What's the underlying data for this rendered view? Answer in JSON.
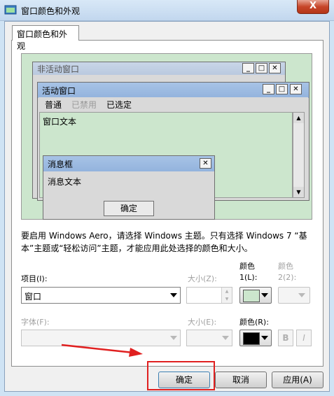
{
  "window": {
    "title": "窗口颜色和外观",
    "close_glyph": "X"
  },
  "tab": {
    "label": "窗口颜色和外观"
  },
  "preview": {
    "inactive_title": "非活动窗口",
    "active_title": "活动窗口",
    "menu": [
      "普通",
      "已禁用",
      "已选定"
    ],
    "window_text": "窗口文本",
    "msgbox_title": "消息框",
    "msgbox_text": "消息文本",
    "msgbox_ok": "确定"
  },
  "notice": "要启用 Windows Aero，请选择 Windows 主题。只有选择 Windows 7 “基本”主题或“轻松访问”主题，才能应用此处选择的颜色和大小。",
  "form": {
    "item_label": "项目(I):",
    "item_value": "窗口",
    "size1_label": "大小(Z):",
    "color1_label_a": "颜色",
    "color1_label_b": "1(L):",
    "color2_label_a": "颜色",
    "color2_label_b": "2(2):",
    "font_label": "字体(F):",
    "size2_label": "大小(E):",
    "fontcolor_label": "颜色(R):",
    "bold": "B",
    "italic": "I",
    "color1_swatch": "#cce6cd",
    "fontcolor_swatch": "#000000"
  },
  "buttons": {
    "ok": "确定",
    "cancel": "取消",
    "apply": "应用(A)"
  },
  "annotation_colors": {
    "highlight": "#e02020"
  }
}
